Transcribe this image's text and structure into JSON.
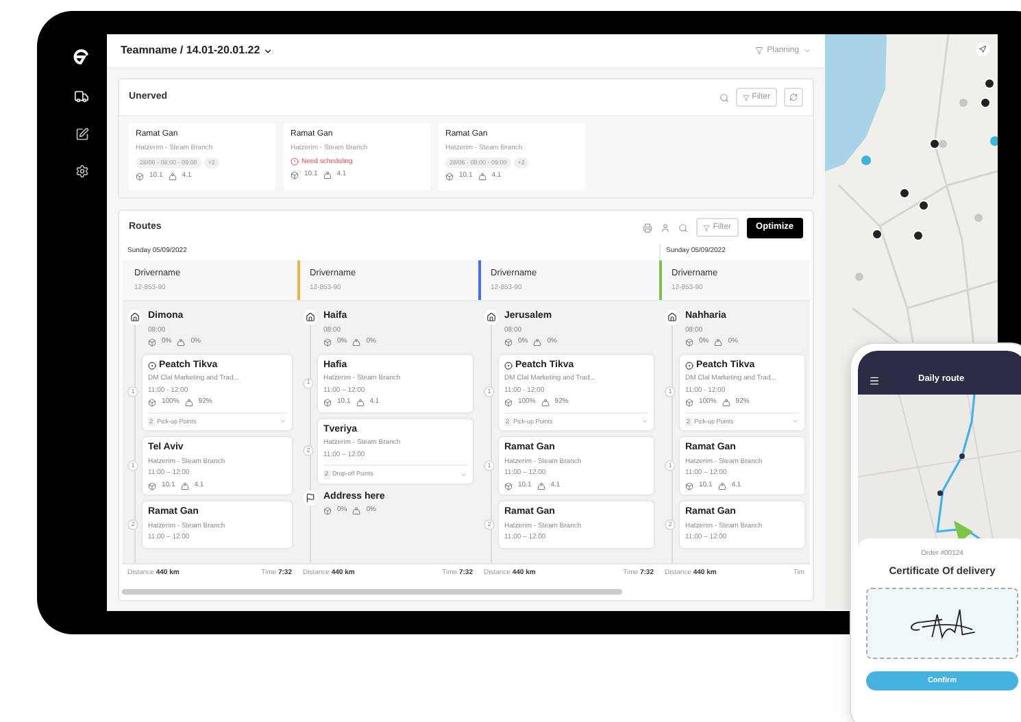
{
  "header": {
    "title": "Teamname / 14.01-20.01.22",
    "view": "Planning"
  },
  "unserved": {
    "title": "Unerved",
    "filter": "Filter",
    "cards": [
      {
        "kind": "slot",
        "city": "Ramat Gan",
        "branch": "Hatzerim - Steam Branch",
        "slot": "28/06 · 08:00 - 09:00",
        "extra": "+2",
        "capacity": "10.1",
        "load": "4.1"
      },
      {
        "kind": "alert",
        "city": "Ramat Gan",
        "branch": "Hatzerim - Steam Branch",
        "alert": "Need scheduling",
        "capacity": "10.1",
        "load": "4.1"
      },
      {
        "kind": "slot",
        "city": "Ramat Gan",
        "branch": "Hatzerim - Steam Branch",
        "slot": "28/06 · 08:00 - 09:00",
        "extra": "+2",
        "capacity": "10.1",
        "load": "4.1"
      }
    ]
  },
  "routes": {
    "title": "Routes",
    "filter": "Filter",
    "optimize": "Optimize",
    "columns": [
      {
        "date": "Sunday 05/09/2022",
        "driver": "Drivername",
        "plate": "12-853-90",
        "stops": [
          {
            "kind": "start",
            "city": "Dimona",
            "time": "08:00",
            "capacity": "0%",
            "load": "0%"
          },
          {
            "kind": "card",
            "cluster": true,
            "index": "1",
            "city": "Peatch Tikva",
            "branch": "DM Clal Marketing and Trad...",
            "time": "11:00 - 12:00",
            "capacity": "100%",
            "load": "92%",
            "points_count": "2",
            "points_label": "Pick-up Points"
          },
          {
            "kind": "card",
            "index": "1",
            "city": "Tel Aviv",
            "branch": "Hatzerim - Steam Branch",
            "time": "11:00 – 12:00",
            "capacity": "10.1",
            "load": "4.1"
          },
          {
            "kind": "card",
            "index": "2",
            "city": "Ramat Gan",
            "branch": "Hatzerim - Steam Branch",
            "time": "11:00 – 12:00"
          }
        ],
        "distance": "Distance **440 km**",
        "duration": "Time **7:32**"
      },
      {
        "driver": "Drivername",
        "plate": "12-853-90",
        "color": "#f2b33d",
        "stops": [
          {
            "kind": "start",
            "city": "Haifa",
            "time": "08:00",
            "capacity": "0%",
            "load": "0%"
          },
          {
            "kind": "card",
            "index": "1",
            "city": "Hafia",
            "branch": "Hatzerim - Steam Branch",
            "time": "11:00 – 12:00",
            "capacity": "10.1",
            "load": "4.1"
          },
          {
            "kind": "card",
            "index": "2",
            "city": "Tveriya",
            "branch": "Hatzerim - Steam Branch",
            "time": "11:00 – 12:00",
            "points_count": "2",
            "points_label": "Drop-off Points"
          },
          {
            "kind": "end",
            "city": "Address here",
            "capacity": "0%",
            "load": "0%"
          }
        ],
        "distance": "Distance **440 km**",
        "duration": "Time **7:32**"
      },
      {
        "driver": "Drivername",
        "plate": "12-853-90",
        "color": "#4a6cf0",
        "stops": [
          {
            "kind": "start",
            "city": "Jerusalem",
            "time": "08:00",
            "capacity": "0%",
            "load": "0%"
          },
          {
            "kind": "card",
            "cluster": true,
            "index": "1",
            "city": "Peatch Tikva",
            "branch": "DM Clal Marketing and Trad...",
            "time": "11:00 - 12:00",
            "capacity": "100%",
            "load": "92%",
            "points_count": "2",
            "points_label": "Pick-up Points"
          },
          {
            "kind": "card",
            "index": "1",
            "city": "Ramat Gan",
            "branch": "Hatzerim - Steam Branch",
            "time": "11:00 – 12:00",
            "capacity": "10.1",
            "load": "4.1"
          },
          {
            "kind": "card",
            "index": "2",
            "city": "Ramat Gan",
            "branch": "Hatzerim - Steam Branch",
            "time": "11:00 – 12:00"
          }
        ],
        "distance": "Distance **440 km**",
        "duration": "Time **7:32**"
      },
      {
        "date": "Sunday 05/09/2022",
        "driver": "Drivername",
        "plate": "12-853-90",
        "color": "#7cc34a",
        "stops": [
          {
            "kind": "start",
            "city": "Nahharia",
            "time": "08:00",
            "capacity": "0%",
            "load": "0%"
          },
          {
            "kind": "card",
            "cluster": true,
            "index": "1",
            "city": "Peatch Tikva",
            "branch": "DM Clal Marketing and Trad...",
            "time": "11:00 - 12:00",
            "capacity": "100%",
            "load": "92%",
            "points_count": "2",
            "points_label": "Pick-up Points"
          },
          {
            "kind": "card",
            "index": "1",
            "city": "Ramat Gan",
            "branch": "Hatzerim - Steam Branch",
            "time": "11:00 – 12:00",
            "capacity": "10.1",
            "load": "4.1"
          },
          {
            "kind": "card",
            "index": "2",
            "city": "Ramat Gan",
            "branch": "Hatzerim - Steam Branch",
            "time": "11:00 – 12:00"
          }
        ],
        "distance": "Distance **440 km**",
        "duration": "Tim"
      }
    ]
  },
  "phone": {
    "title": "Daily route",
    "order": "Order #00124",
    "heading": "Certificate Of delivery",
    "confirm": "Confirm"
  }
}
